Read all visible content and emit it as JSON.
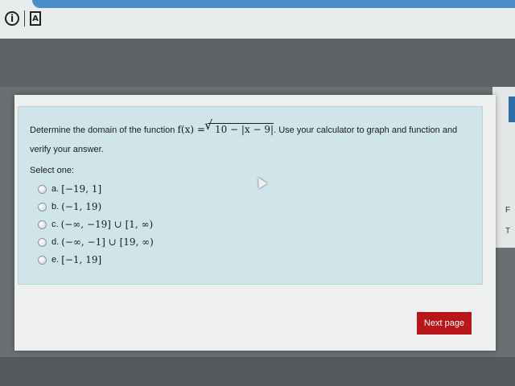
{
  "toolbar": {
    "info_icon": "info-icon",
    "doc_icon": "document-icon",
    "doc_glyph": "A"
  },
  "side": {
    "letter_1": "F",
    "letter_2": "T"
  },
  "question": {
    "text_before": "Determine the domain of the function",
    "func_lhs": "f(x) =",
    "func_radicand": "10 − |x − 9|",
    "text_after": ". Use your calculator to graph and function and verify your answer.",
    "select_label": "Select one:",
    "options": [
      {
        "letter": "a.",
        "value": "[−19, 1]"
      },
      {
        "letter": "b.",
        "value": "(−1, 19)"
      },
      {
        "letter": "c.",
        "value": "(−∞, −19] ∪ [1, ∞)"
      },
      {
        "letter": "d.",
        "value": "(−∞, −1] ∪ [19, ∞)"
      },
      {
        "letter": "e.",
        "value": "[−1, 19]"
      }
    ]
  },
  "navigation": {
    "next_label": "Next page"
  },
  "colors": {
    "accent_blue": "#4a8cc8",
    "question_bg": "#cfe5ea",
    "next_button": "#b8161b"
  }
}
